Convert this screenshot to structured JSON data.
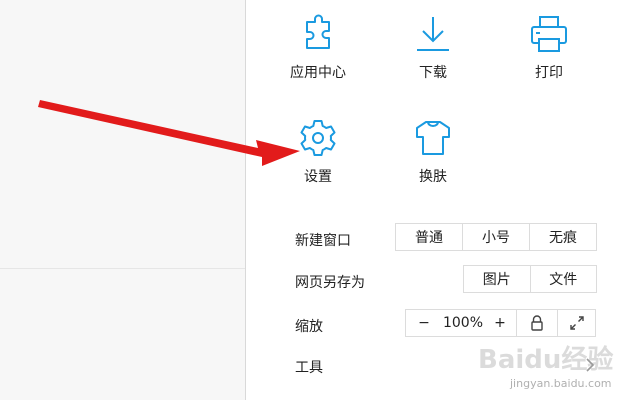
{
  "grid": [
    {
      "label": "应用中心",
      "icon": "puzzle-icon"
    },
    {
      "label": "下载",
      "icon": "download-icon"
    },
    {
      "label": "打印",
      "icon": "printer-icon"
    },
    {
      "label": "设置",
      "icon": "gear-icon"
    },
    {
      "label": "换肤",
      "icon": "tshirt-icon"
    }
  ],
  "rows": {
    "new_window": {
      "label": "新建窗口",
      "options": [
        "普通",
        "小号",
        "无痕"
      ]
    },
    "save_as": {
      "label": "网页另存为",
      "options": [
        "图片",
        "文件"
      ]
    },
    "zoom": {
      "label": "缩放",
      "minus": "−",
      "value": "100%",
      "plus": "+",
      "lock_icon": "lock-icon",
      "fullscreen_icon": "expand-icon"
    },
    "tools": {
      "label": "工具",
      "icon": "chevron-right-icon"
    }
  },
  "watermark": {
    "text": "Baidu经验",
    "sub": "jingyan.baidu.com"
  },
  "colors": {
    "accent": "#1a9ae0",
    "arrow": "#e21b1b",
    "text": "#222222",
    "border": "#dcdcdc"
  }
}
